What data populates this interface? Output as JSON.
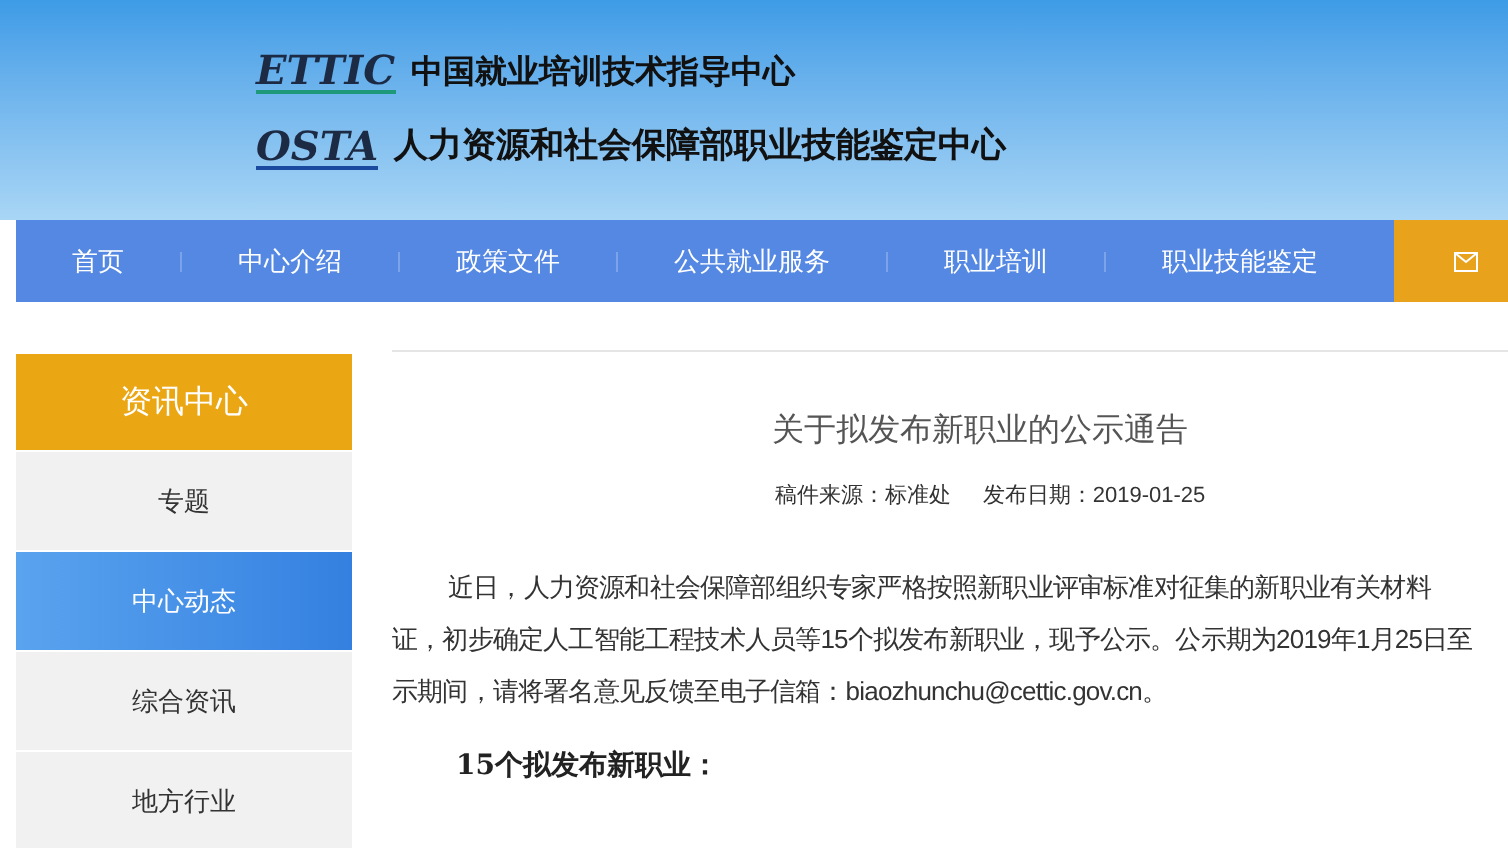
{
  "header": {
    "logos": [
      {
        "mark": "ETTIC",
        "name": "中国就业培训技术指导中心"
      },
      {
        "mark": "OSTA",
        "name": "人力资源和社会保障部职业技能鉴定中心"
      }
    ]
  },
  "nav": {
    "items": [
      {
        "label": "首页"
      },
      {
        "label": "中心介绍"
      },
      {
        "label": "政策文件"
      },
      {
        "label": "公共就业服务"
      },
      {
        "label": "职业培训"
      },
      {
        "label": "职业技能鉴定"
      }
    ]
  },
  "sidebar": {
    "title": "资讯中心",
    "items": [
      {
        "label": "专题",
        "selected": false
      },
      {
        "label": "中心动态",
        "selected": true
      },
      {
        "label": "综合资讯",
        "selected": false
      },
      {
        "label": "地方行业",
        "selected": false
      }
    ]
  },
  "article": {
    "title": "关于拟发布新职业的公示通告",
    "source": "稿件来源：标准处",
    "date": "发布日期：2019-01-25",
    "lines": [
      "近日，人力资源和社会保障部组织专家严格按照新职业评审标准对征集的新职业有关材料",
      "证，初步确定人工智能工程技术人员等15个拟发布新职业，现予公示。公示期为2019年1月25日至",
      "示期间，请将署名意见反馈至电子信箱：biaozhunchu@cettic.gov.cn。"
    ],
    "subheading": "15个拟发布新职业："
  }
}
